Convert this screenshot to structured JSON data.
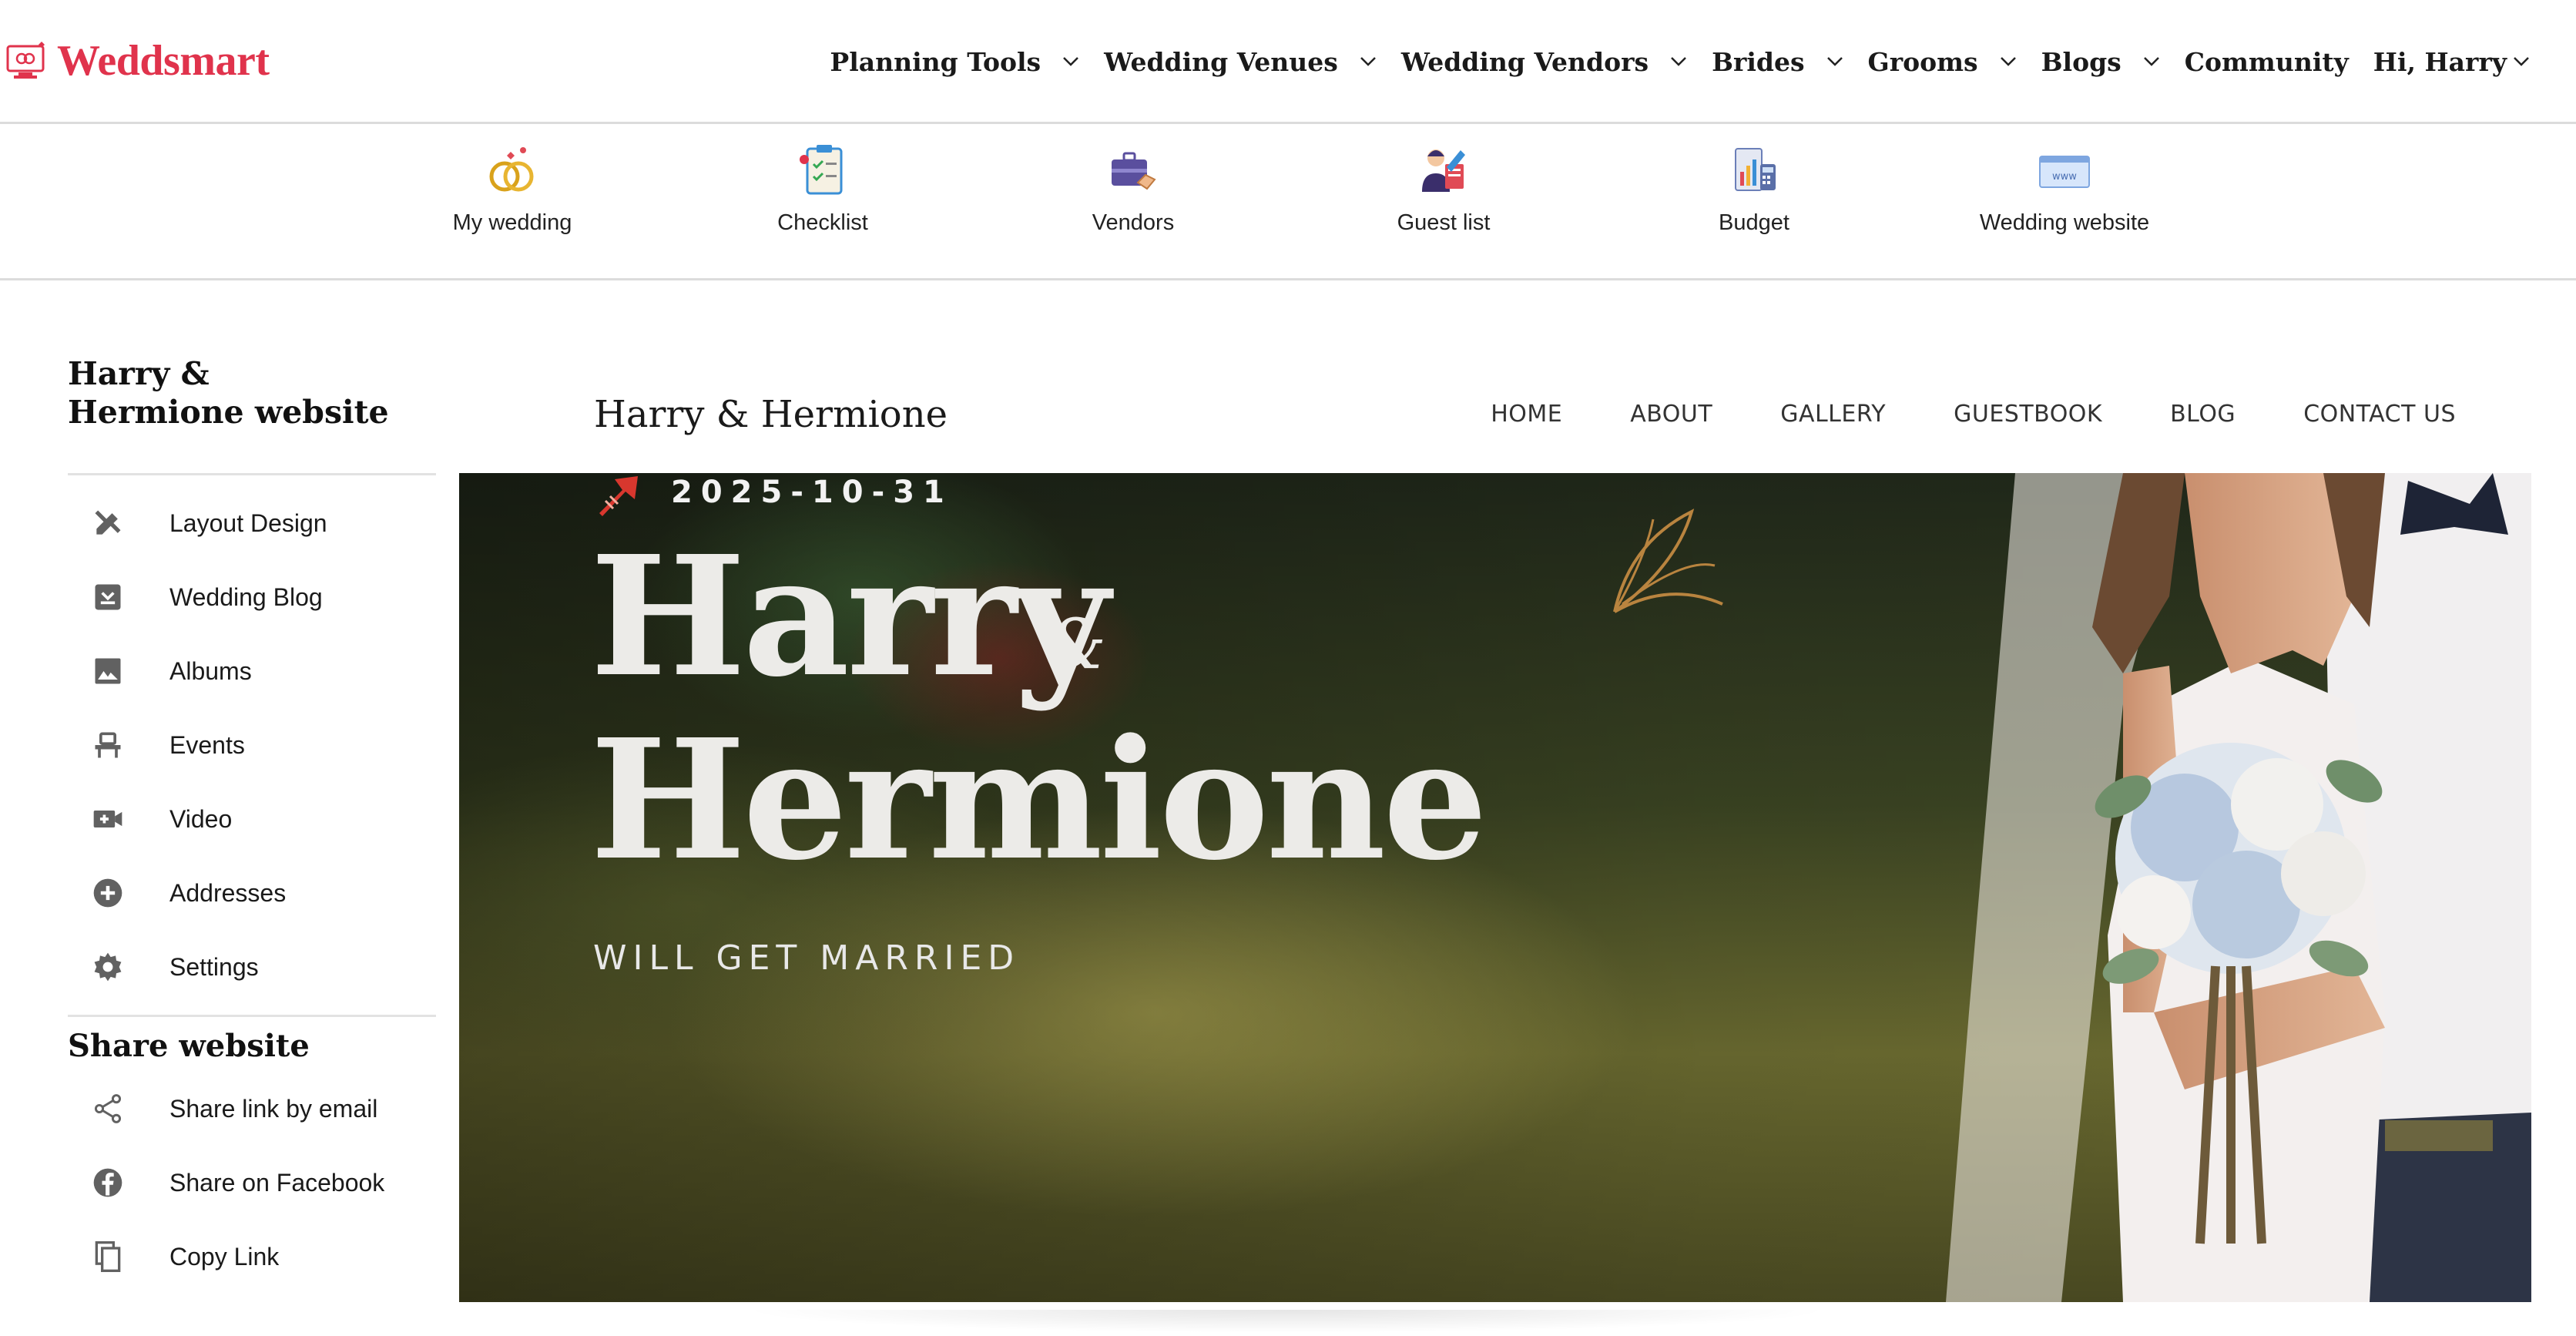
{
  "brand": {
    "name": "Weddsmart",
    "accent": "#e0334c"
  },
  "mainnav": {
    "items": [
      {
        "label": "Planning Tools",
        "has_menu": true
      },
      {
        "label": "Wedding Venues",
        "has_menu": true
      },
      {
        "label": "Wedding Vendors",
        "has_menu": true
      },
      {
        "label": "Brides",
        "has_menu": true
      },
      {
        "label": "Grooms",
        "has_menu": true
      },
      {
        "label": "Blogs",
        "has_menu": true
      },
      {
        "label": "Community",
        "has_menu": false
      },
      {
        "label": "Hi, Harry",
        "has_menu": true
      }
    ]
  },
  "tools": [
    {
      "label": "My wedding",
      "icon": "rings-icon"
    },
    {
      "label": "Checklist",
      "icon": "checklist-icon"
    },
    {
      "label": "Vendors",
      "icon": "vendors-icon"
    },
    {
      "label": "Guest list",
      "icon": "guest-list-icon"
    },
    {
      "label": "Budget",
      "icon": "budget-icon"
    },
    {
      "label": "Wedding website",
      "icon": "website-icon"
    }
  ],
  "sidebar": {
    "title": "Harry & Hermione website",
    "items": [
      {
        "label": "Layout Design",
        "icon": "design-tools-icon"
      },
      {
        "label": "Wedding Blog",
        "icon": "blog-icon"
      },
      {
        "label": "Albums",
        "icon": "image-icon"
      },
      {
        "label": "Events",
        "icon": "event-icon"
      },
      {
        "label": "Video",
        "icon": "video-icon"
      },
      {
        "label": "Addresses",
        "icon": "add-circle-icon"
      },
      {
        "label": "Settings",
        "icon": "gear-icon"
      }
    ],
    "share_title": "Share website",
    "share_items": [
      {
        "label": "Share link by email",
        "icon": "share-icon"
      },
      {
        "label": "Share on Facebook",
        "icon": "facebook-icon"
      },
      {
        "label": "Copy Link",
        "icon": "copy-icon"
      }
    ]
  },
  "preview": {
    "couple_name": "Harry & Hermione",
    "links": [
      "HOME",
      "ABOUT",
      "GALLERY",
      "GUESTBOOK",
      "BLOG",
      "CONTACT US"
    ],
    "hero": {
      "date": "2025-10-31",
      "name1": "Harry",
      "amp": "&",
      "name2": "Hermione",
      "tagline": "WILL GET MARRIED"
    }
  }
}
